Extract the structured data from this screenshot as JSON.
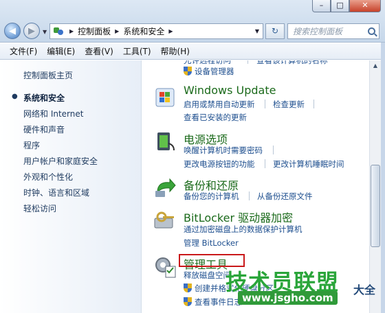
{
  "window": {
    "caption_minimize": "–",
    "caption_maximize": "□",
    "caption_close": "✕"
  },
  "nav": {
    "back_glyph": "◀",
    "forward_glyph": "▶",
    "breadcrumb": [
      "控制面板",
      "系统和安全"
    ],
    "refresh_glyph": "↻",
    "search_placeholder": "搜索控制面板"
  },
  "menu": [
    "文件(F)",
    "编辑(E)",
    "查看(V)",
    "工具(T)",
    "帮助(H)"
  ],
  "sidebar": {
    "home": "控制面板主页",
    "items": [
      "系统和安全",
      "网络和 Internet",
      "硬件和声音",
      "程序",
      "用户帐户和家庭安全",
      "外观和个性化",
      "时钟、语言和区域",
      "轻松访问"
    ],
    "active_index": 0
  },
  "content": {
    "partial_top_links": [
      "允许远程访问",
      "查看该计算机的名称"
    ],
    "device_manager": "设备管理器",
    "categories": [
      {
        "id": "windows-update",
        "title": "Windows Update",
        "links": [
          [
            "启用或禁用自动更新",
            "检查更新"
          ],
          [
            "查看已安装的更新"
          ]
        ]
      },
      {
        "id": "power",
        "title": "电源选项",
        "links": [
          [
            "唤醒计算机时需要密码"
          ],
          [
            "更改电源按钮的功能",
            "更改计算机睡眠时间"
          ]
        ]
      },
      {
        "id": "backup",
        "title": "备份和还原",
        "links": [
          [
            "备份您的计算机",
            "从备份还原文件"
          ]
        ]
      },
      {
        "id": "bitlocker",
        "title": "BitLocker 驱动器加密",
        "links": [
          [
            "通过加密磁盘上的数据保护计算机"
          ],
          [
            "管理 BitLocker"
          ]
        ]
      },
      {
        "id": "admin-tools",
        "title": "管理工具",
        "links": [
          [
            "释放磁盘空间"
          ],
          [
            "创建并格式化硬盘分区"
          ],
          [
            "查看事件日志"
          ]
        ]
      }
    ]
  },
  "watermark": {
    "brand": "技术员联盟",
    "url": "www.jsgho.com",
    "side": "大全"
  },
  "colors": {
    "category_title": "#1b6a1b",
    "link": "#1e4f8f",
    "highlight": "#c9181a"
  }
}
